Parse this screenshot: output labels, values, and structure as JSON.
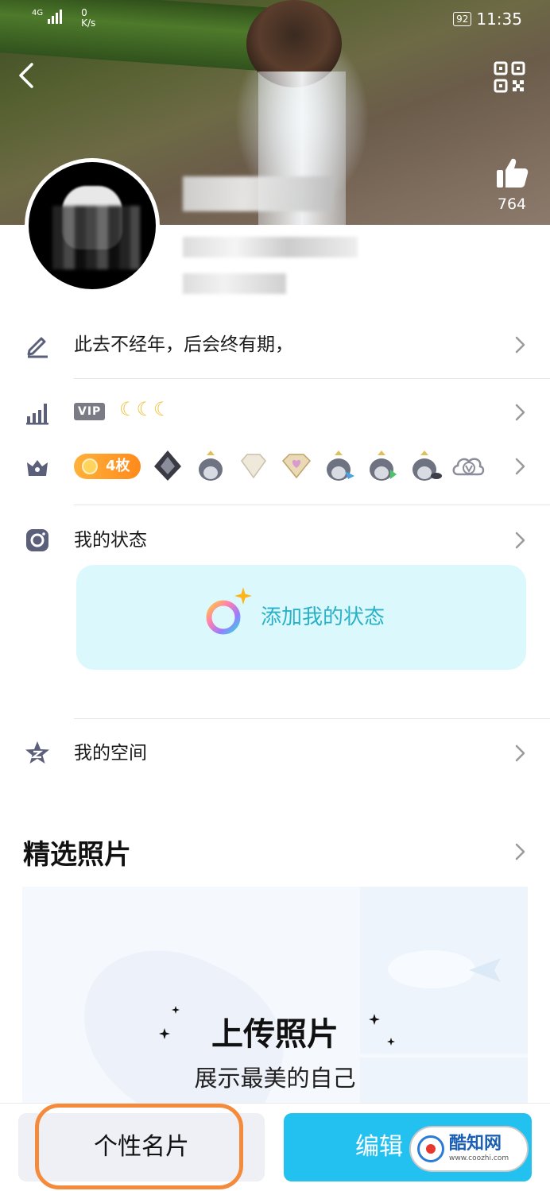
{
  "status_bar": {
    "network": "4G",
    "speed_value": "0",
    "speed_unit": "K/s",
    "battery": "92",
    "time": "11:35"
  },
  "header": {
    "like_count": "764"
  },
  "rows": {
    "signature": "此去不经年，后会终有期，",
    "vip_tag": "VIP",
    "vip_moons": "☾☾☾",
    "medal_count": "4枚",
    "status_label": "我的状态",
    "status_card_text": "添加我的状态",
    "space_label": "我的空间"
  },
  "photos": {
    "section_title": "精选照片",
    "upload_title": "上传照片",
    "upload_subtitle": "展示最美的自己"
  },
  "bottom": {
    "card_button": "个性名片",
    "edit_button": "编辑"
  },
  "watermark": {
    "title": "酷知网",
    "url": "www.coozhi.com"
  },
  "colors": {
    "signature": "#2c8ed8",
    "status_card_bg": "#dbf9fc",
    "status_card_text": "#2ab1c7",
    "edit_button_bg": "#22c1ef",
    "annotation_outline": "#f38a3c",
    "medal_pill": "#ff9a2a"
  },
  "icons": {
    "back": "chevron-left-icon",
    "qr": "qr-code-icon",
    "like": "thumbs-up-icon",
    "signature": "pencil-icon",
    "vip": "level-chart-icon",
    "medals": "crown-icon",
    "status": "camera-icon",
    "space": "star-z-icon",
    "chevron": "chevron-right-icon"
  }
}
